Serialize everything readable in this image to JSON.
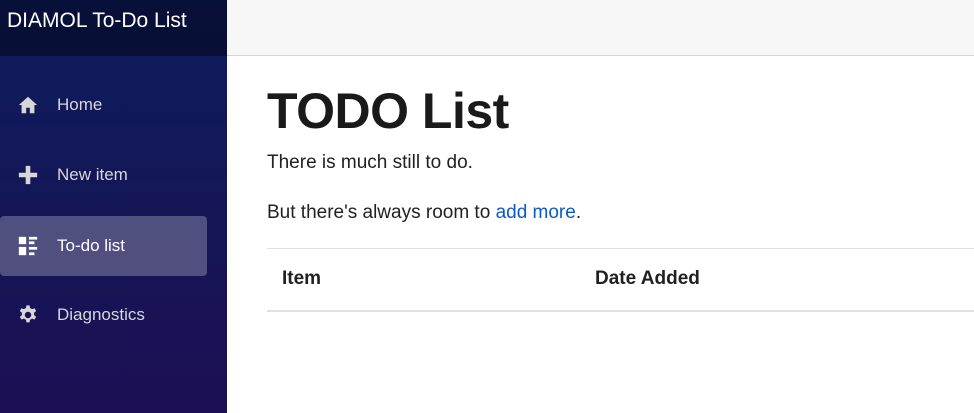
{
  "sidebar": {
    "brand": "DIAMOL To-Do List",
    "items": [
      {
        "label": "Home",
        "icon": "home-icon",
        "active": false
      },
      {
        "label": "New item",
        "icon": "plus-icon",
        "active": false
      },
      {
        "label": "To-do list",
        "icon": "list-icon",
        "active": true
      },
      {
        "label": "Diagnostics",
        "icon": "gear-icon",
        "active": false
      }
    ]
  },
  "main": {
    "title": "TODO List",
    "intro": "There is much still to do.",
    "room_prefix": "But there's always room to ",
    "room_link": "add more",
    "room_suffix": ".",
    "table": {
      "columns": [
        "Item",
        "Date Added"
      ]
    }
  },
  "colors": {
    "sidebar_top": "#0d1b5e",
    "sidebar_bottom": "#1d0f55",
    "link": "#0a58ca"
  }
}
